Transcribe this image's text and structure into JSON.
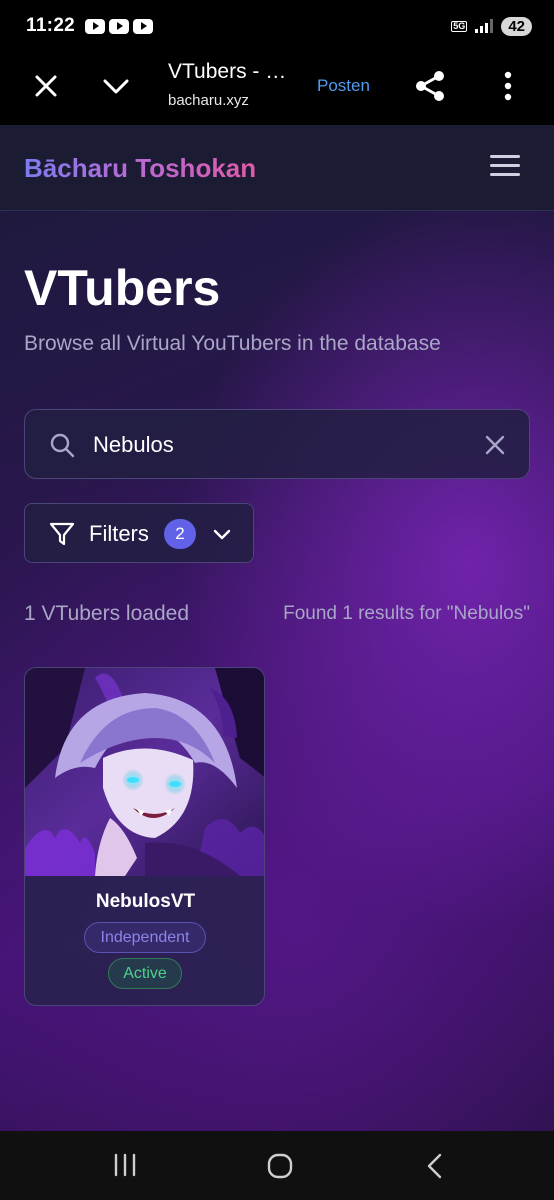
{
  "status_bar": {
    "time": "11:22",
    "network": "5G",
    "battery": "42"
  },
  "browser": {
    "page_title": "VTubers - …",
    "url": "bacharu.xyz",
    "posten_label": "Posten"
  },
  "site": {
    "brand": "Bācharu Toshokan",
    "page_title": "VTubers",
    "subtitle": "Browse all Virtual YouTubers in the database",
    "search": {
      "value": "Nebulos"
    },
    "filters": {
      "label": "Filters",
      "count": "2"
    },
    "loaded_count": "1 VTubers loaded",
    "results_text": "Found 1 results for \"Nebulos\"",
    "cards": [
      {
        "name": "NebulosVT",
        "affiliation": "Independent",
        "status": "Active"
      }
    ]
  },
  "colors": {
    "accent": "#6262e8",
    "active_green": "#4ed18c",
    "link_blue": "#4e9df2",
    "background_purple": "#3f1370"
  },
  "icons": {
    "close": "close-icon",
    "chevron": "chevron-down-icon",
    "share": "share-icon",
    "more": "more-vert-icon",
    "menu": "hamburger-menu-icon",
    "search": "search-icon",
    "clear": "clear-icon",
    "filter": "filter-icon"
  }
}
